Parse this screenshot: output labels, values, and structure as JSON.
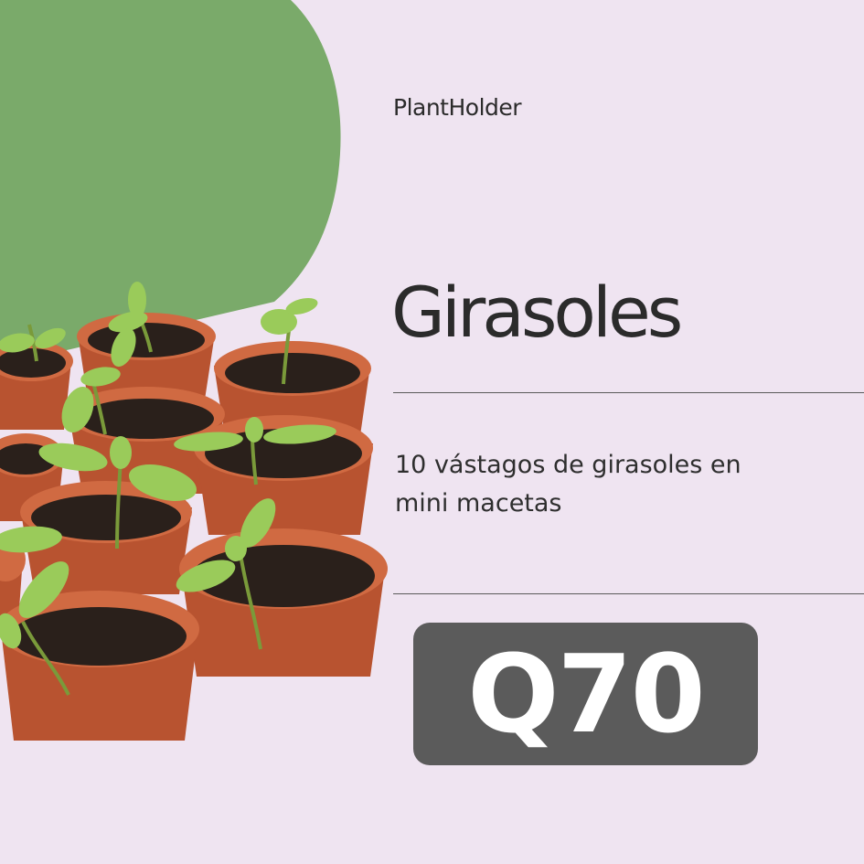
{
  "brand": "PlantHolder",
  "title": "Girasoles",
  "description": "10 vástagos de girasoles en mini macetas",
  "price": "Q70",
  "colors": {
    "background": "#efe4f1",
    "blob": "#7aaa6a",
    "price_box": "#5b5b5b",
    "pot": "#c8603a",
    "soil": "#2a201b",
    "leaf": "#9acb5a"
  }
}
